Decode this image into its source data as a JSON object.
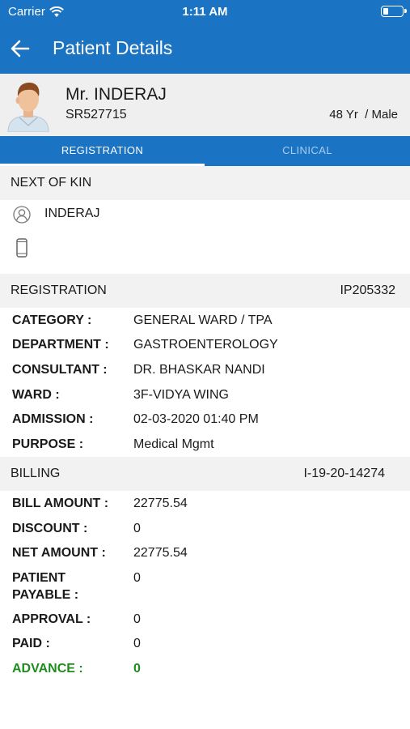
{
  "status_bar": {
    "carrier": "Carrier",
    "time": "1:11 AM"
  },
  "nav": {
    "title": "Patient Details"
  },
  "patient": {
    "name": "Mr. INDERAJ",
    "id": "SR527715",
    "age_sex": "48 Yr  / Male"
  },
  "tabs": {
    "registration": "REGISTRATION",
    "clinical": "CLINICAL"
  },
  "next_of_kin": {
    "header": "NEXT OF KIN",
    "name": "INDERAJ",
    "phone": ""
  },
  "registration": {
    "header": "REGISTRATION",
    "number": "IP205332",
    "fields": [
      {
        "label": "CATEGORY :",
        "value": "GENERAL WARD / TPA"
      },
      {
        "label": "DEPARTMENT :",
        "value": "GASTROENTEROLOGY"
      },
      {
        "label": "CONSULTANT :",
        "value": "DR. BHASKAR NANDI"
      },
      {
        "label": "WARD :",
        "value": "3F-VIDYA WING"
      },
      {
        "label": "ADMISSION :",
        "value": "02-03-2020 01:40 PM"
      },
      {
        "label": "PURPOSE :",
        "value": "Medical Mgmt"
      }
    ]
  },
  "billing": {
    "header": "BILLING",
    "number": "I-19-20-14274",
    "fields": [
      {
        "label": "BILL AMOUNT :",
        "value": "22775.54"
      },
      {
        "label": "DISCOUNT :",
        "value": "0"
      },
      {
        "label": "NET AMOUNT :",
        "value": "22775.54"
      },
      {
        "label": "PATIENT PAYABLE :",
        "value": "0"
      },
      {
        "label": "APPROVAL :",
        "value": "0"
      },
      {
        "label": "PAID :",
        "value": "0"
      },
      {
        "label": "ADVANCE :",
        "value": "0"
      }
    ]
  },
  "colors": {
    "primary": "#1a73c3",
    "advance": "#1e8c1e",
    "section_bg": "#f2f2f2"
  }
}
